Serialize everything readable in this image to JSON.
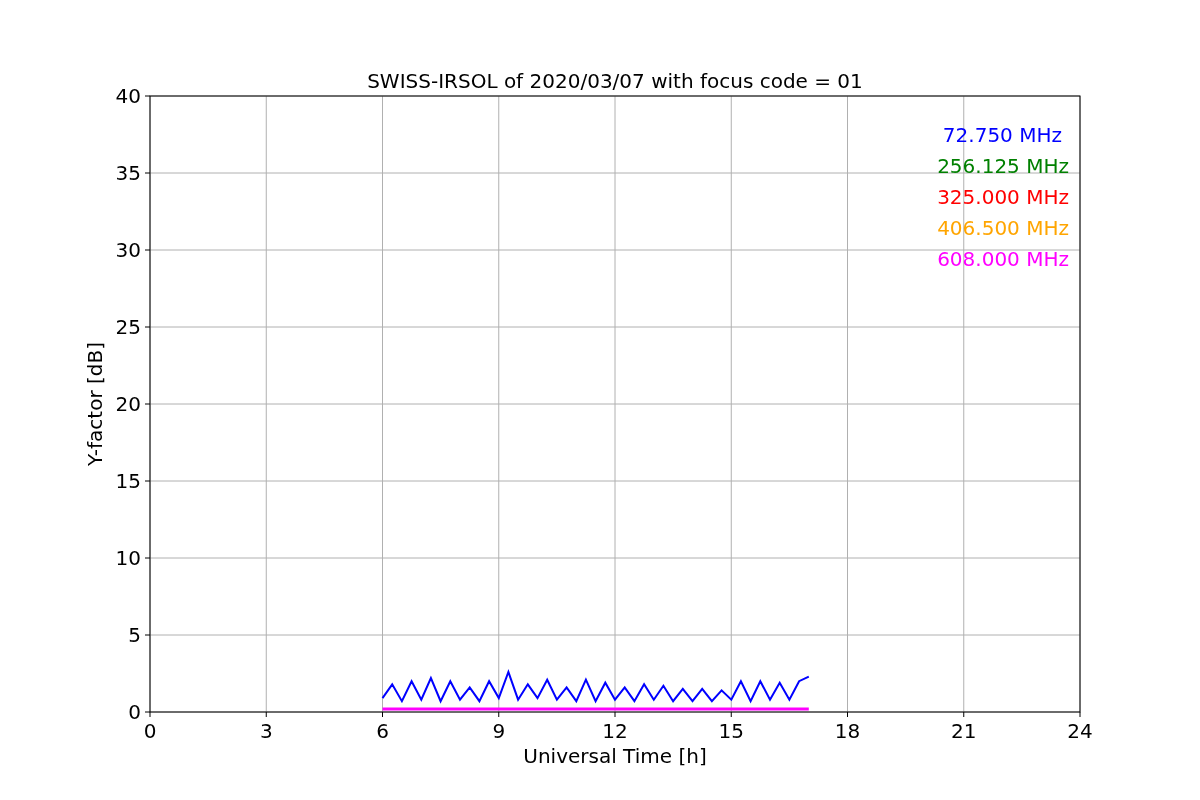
{
  "chart_data": {
    "type": "line",
    "title": "SWISS-IRSOL of 2020/03/07 with focus code = 01",
    "xlabel": "Universal Time [h]",
    "ylabel": "Y-factor [dB]",
    "x": [
      6,
      6.25,
      6.5,
      6.75,
      7,
      7.25,
      7.5,
      7.75,
      8,
      8.25,
      8.5,
      8.75,
      9,
      9.25,
      9.5,
      9.75,
      10,
      10.25,
      10.5,
      10.75,
      11,
      11.25,
      11.5,
      11.75,
      12,
      12.25,
      12.5,
      12.75,
      13,
      13.25,
      13.5,
      13.75,
      14,
      14.25,
      14.5,
      14.75,
      15,
      15.25,
      15.5,
      15.75,
      16,
      16.25,
      16.5,
      16.75,
      17
    ],
    "xlim": [
      0,
      24
    ],
    "grid": true,
    "ylim": [
      0,
      40
    ],
    "xticks": [
      0,
      3,
      6,
      9,
      12,
      15,
      18,
      21,
      24
    ],
    "yticks": [
      0,
      5,
      10,
      15,
      20,
      25,
      30,
      35,
      40
    ],
    "series": [
      {
        "name": "72.750 MHz",
        "color": "#0000ff",
        "values": [
          0.9,
          1.8,
          0.7,
          2.0,
          0.8,
          2.2,
          0.7,
          2.0,
          0.8,
          1.6,
          0.7,
          2.0,
          0.9,
          2.6,
          0.8,
          1.8,
          0.9,
          2.1,
          0.8,
          1.6,
          0.7,
          2.1,
          0.7,
          1.9,
          0.8,
          1.6,
          0.7,
          1.8,
          0.8,
          1.7,
          0.7,
          1.5,
          0.7,
          1.5,
          0.7,
          1.4,
          0.8,
          2.0,
          0.7,
          2.0,
          0.8,
          1.9,
          0.8,
          2.0,
          2.3
        ]
      },
      {
        "name": "256.125 MHz",
        "color": "#008000",
        "values": [
          null,
          null,
          null,
          null,
          null,
          null,
          null,
          null,
          null,
          null,
          null,
          null,
          null,
          null,
          null,
          null,
          null,
          null,
          null,
          null,
          null,
          null,
          null,
          null,
          null,
          null,
          null,
          null,
          null,
          null,
          null,
          null,
          null,
          null,
          null,
          null,
          null,
          null,
          null,
          null,
          null,
          null,
          null,
          null,
          null
        ]
      },
      {
        "name": "325.000 MHz",
        "color": "#ff0000",
        "values": [
          null,
          null,
          null,
          null,
          null,
          null,
          null,
          null,
          null,
          null,
          null,
          null,
          null,
          null,
          null,
          null,
          null,
          null,
          null,
          null,
          null,
          null,
          null,
          null,
          null,
          null,
          null,
          null,
          null,
          null,
          null,
          null,
          null,
          null,
          null,
          null,
          null,
          null,
          null,
          null,
          null,
          null,
          null,
          null,
          null
        ]
      },
      {
        "name": "406.500 MHz",
        "color": "#ffa500",
        "values": [
          null,
          null,
          null,
          null,
          null,
          null,
          null,
          null,
          null,
          null,
          null,
          null,
          null,
          null,
          null,
          null,
          null,
          null,
          null,
          null,
          null,
          null,
          null,
          null,
          null,
          null,
          null,
          null,
          null,
          null,
          null,
          null,
          null,
          null,
          null,
          null,
          null,
          null,
          null,
          null,
          null,
          null,
          null,
          null,
          null
        ]
      },
      {
        "name": "608.000 MHz",
        "color": "#ff00ff",
        "values": [
          0.2,
          0.2,
          0.2,
          0.2,
          0.2,
          0.2,
          0.2,
          0.2,
          0.2,
          0.2,
          0.2,
          0.2,
          0.2,
          0.2,
          0.2,
          0.2,
          0.2,
          0.2,
          0.2,
          0.2,
          0.2,
          0.2,
          0.2,
          0.2,
          0.2,
          0.2,
          0.2,
          0.2,
          0.2,
          0.2,
          0.2,
          0.2,
          0.2,
          0.2,
          0.2,
          0.2,
          0.2,
          0.2,
          0.2,
          0.2,
          0.2,
          0.2,
          0.2,
          0.2,
          0.2
        ]
      }
    ]
  }
}
